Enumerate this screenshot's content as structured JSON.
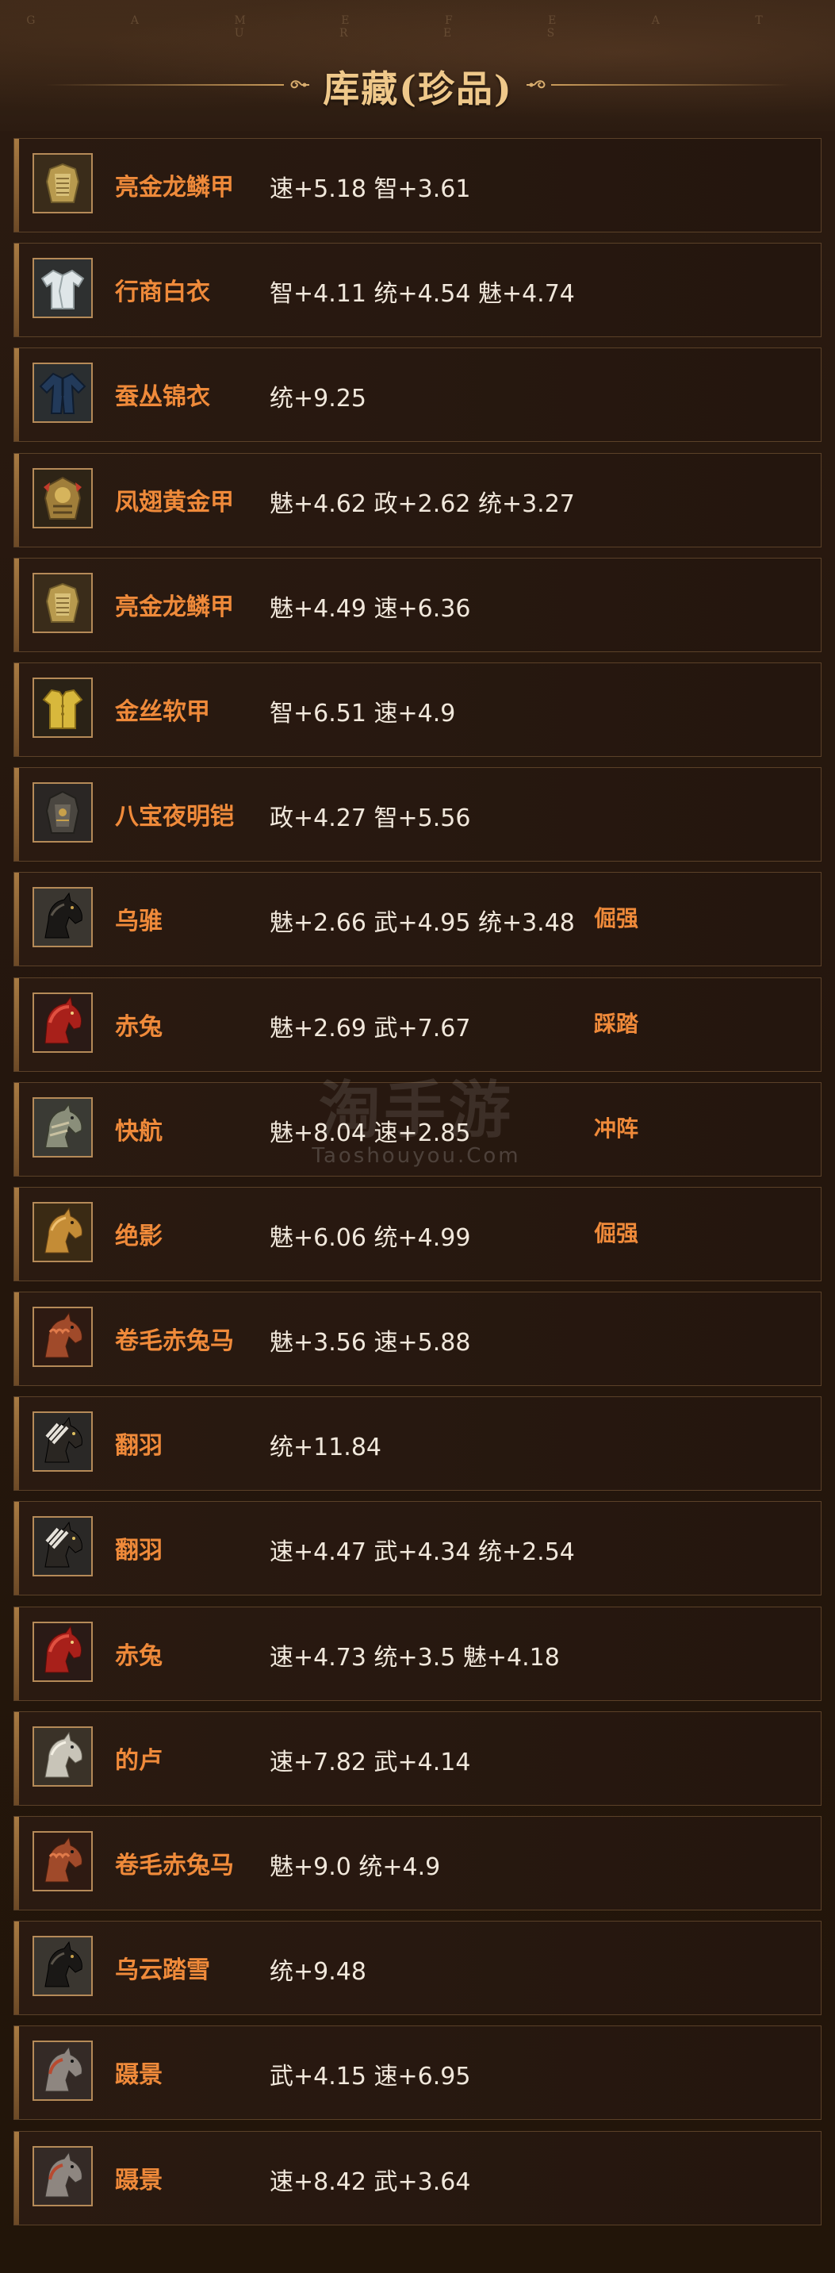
{
  "header": {
    "decor_letters": "G A M E   F E A T U R E S",
    "title": "库藏(珍品)"
  },
  "watermark": {
    "cn": "淘手游",
    "en": "Taoshouyou.Com"
  },
  "colors": {
    "item_name": "#ef8a3a",
    "stats_text": "#f1e8dc",
    "title": "#efc88a",
    "row_border": "#5b4128"
  },
  "items": [
    {
      "name": "亮金龙鳞甲",
      "stats": "速+5.18 智+3.61",
      "skill": "",
      "icon": "gold-armor-icon"
    },
    {
      "name": "行商白衣",
      "stats": "智+4.11 统+4.54 魅+4.74",
      "skill": "",
      "icon": "white-robe-icon"
    },
    {
      "name": "蚕丛锦衣",
      "stats": "统+9.25",
      "skill": "",
      "icon": "blue-robe-icon"
    },
    {
      "name": "凤翅黄金甲",
      "stats": "魅+4.62 政+2.62 统+3.27",
      "skill": "",
      "icon": "phoenix-armor-icon"
    },
    {
      "name": "亮金龙鳞甲",
      "stats": "魅+4.49 速+6.36",
      "skill": "",
      "icon": "gold-armor-icon"
    },
    {
      "name": "金丝软甲",
      "stats": "智+6.51 速+4.9",
      "skill": "",
      "icon": "gold-vest-icon"
    },
    {
      "name": "八宝夜明铠",
      "stats": "政+4.27 智+5.56",
      "skill": "",
      "icon": "dark-armor-icon"
    },
    {
      "name": "乌骓",
      "stats": "魅+2.66 武+4.95 统+3.48",
      "skill": "倔强",
      "icon": "black-horse-icon"
    },
    {
      "name": "赤兔",
      "stats": "魅+2.69 武+7.67",
      "skill": "踩踏",
      "icon": "red-horse-icon"
    },
    {
      "name": "快航",
      "stats": "魅+8.04 速+2.85",
      "skill": "冲阵",
      "icon": "armored-horse-icon"
    },
    {
      "name": "绝影",
      "stats": "魅+6.06 统+4.99",
      "skill": "倔强",
      "icon": "golden-horse-icon"
    },
    {
      "name": "卷毛赤兔马",
      "stats": "魅+3.56 速+5.88",
      "skill": "",
      "icon": "curly-horse-icon"
    },
    {
      "name": "翻羽",
      "stats": "统+11.84",
      "skill": "",
      "icon": "feather-horse-icon"
    },
    {
      "name": "翻羽",
      "stats": "速+4.47 武+4.34 统+2.54",
      "skill": "",
      "icon": "feather-horse-icon"
    },
    {
      "name": "赤兔",
      "stats": "速+4.73 统+3.5 魅+4.18",
      "skill": "",
      "icon": "red-horse-icon"
    },
    {
      "name": "的卢",
      "stats": "速+7.82 武+4.14",
      "skill": "",
      "icon": "white-horse-icon"
    },
    {
      "name": "卷毛赤兔马",
      "stats": "魅+9.0 统+4.9",
      "skill": "",
      "icon": "curly-horse-icon"
    },
    {
      "name": "乌云踏雪",
      "stats": "统+9.48",
      "skill": "",
      "icon": "black-horse-icon"
    },
    {
      "name": "蹑景",
      "stats": "武+4.15 速+6.95",
      "skill": "",
      "icon": "grey-horse-icon"
    },
    {
      "name": "蹑景",
      "stats": "速+8.42 武+3.64",
      "skill": "",
      "icon": "grey-horse-icon"
    }
  ]
}
